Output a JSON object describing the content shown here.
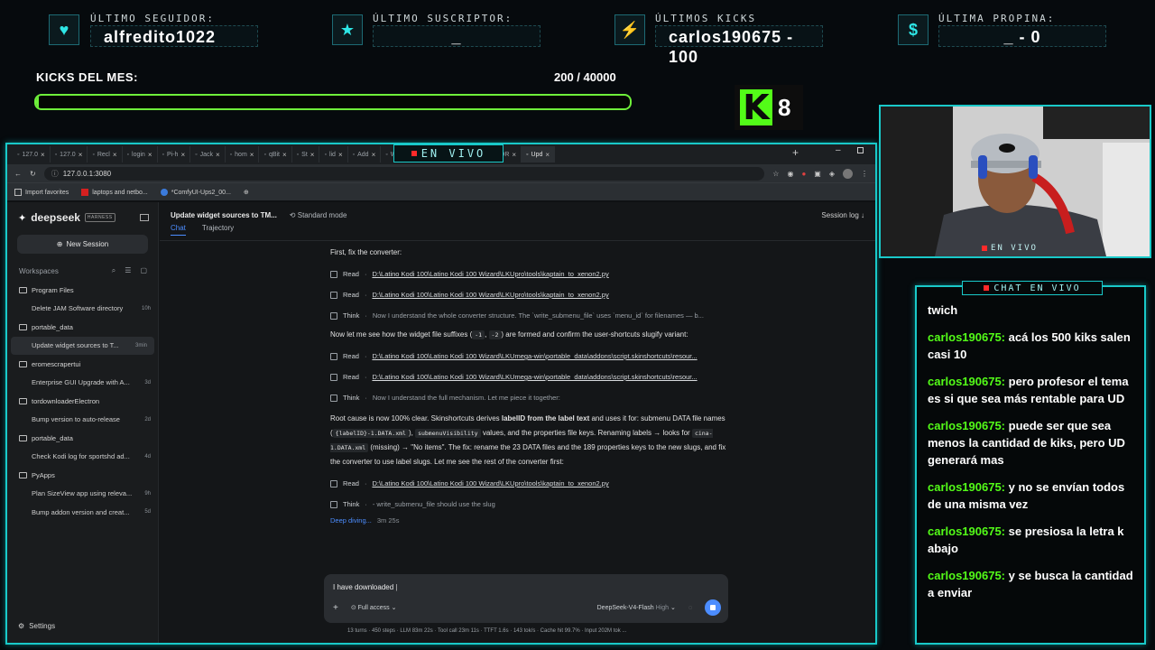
{
  "stats": [
    {
      "label": "ÚLTIMO SEGUIDOR:",
      "value": "alfredito1022",
      "icon": "heart-icon"
    },
    {
      "label": "ÚLTIMO SUSCRIPTOR:",
      "value": "_",
      "icon": "star-icon"
    },
    {
      "label": "ÚLTIMOS KICKS",
      "value": "carlos190675 - 100",
      "icon": "bolt-icon"
    },
    {
      "label": "ÚLTIMA PROPINA:",
      "value": "_ - 0",
      "icon": "dollar-icon"
    }
  ],
  "kicks": {
    "label": "KICKS DEL MES:",
    "count": "200 / 40000",
    "progress_percent": 0.5
  },
  "kick_badge": {
    "letter": "K",
    "number": "8"
  },
  "browser": {
    "tabs": [
      "127.0",
      "127.0",
      "Recl",
      "login",
      "Pi-h",
      "Jack",
      "hom",
      "qBit",
      "St",
      "lid",
      "Add",
      "Wan",
      "Sear",
      "Plain",
      "TOR",
      "Upd"
    ],
    "live_banner": "EN VIVO",
    "url": "127.0.0.1:3080",
    "bookmarks": [
      "Import favorites",
      "laptops and netbo...",
      "*ComfyUI-Ups2_00..."
    ]
  },
  "sidebar": {
    "logo": "deepseek",
    "badge": "HARNESS",
    "new_session": "New Session",
    "workspaces_label": "Workspaces",
    "groups": [
      {
        "name": "Program Files",
        "items": [
          {
            "title": "Delete JAM Software directory",
            "time": "10h"
          }
        ]
      },
      {
        "name": "portable_data",
        "items": [
          {
            "title": "Update widget sources to T...",
            "time": "3min"
          }
        ]
      },
      {
        "name": "eromescrapertui",
        "items": [
          {
            "title": "Enterprise GUI Upgrade with A...",
            "time": "3d"
          }
        ]
      },
      {
        "name": "tordownloaderElectron",
        "items": [
          {
            "title": "Bump version to auto-release",
            "time": "2d"
          }
        ]
      },
      {
        "name": "portable_data",
        "items": [
          {
            "title": "Check Kodi log for sportshd ad...",
            "time": "4d"
          }
        ]
      },
      {
        "name": "PyApps",
        "items": [
          {
            "title": "Plan SizeView app using releva...",
            "time": "9h"
          },
          {
            "title": "Bump addon version and creat...",
            "time": "5d"
          }
        ]
      }
    ],
    "settings": "Settings"
  },
  "main": {
    "title": "Update widget sources to TM...",
    "mode": "Standard mode",
    "session_log": "Session log",
    "tabs": [
      "Chat",
      "Trajectory"
    ],
    "p1": "First, fix the converter:",
    "read_label": "Read",
    "think_label": "Think",
    "path_a": "D:\\Latino Kodi 100\\Latino Kodi 100 Wizard\\LKUpro\\tools\\kaptain_to_xenon2.py",
    "path_b": "D:\\Latino Kodi 100\\Latino Kodi 100 Wizard\\LKUmega-win\\portable_data\\addons\\script.skinshortcuts\\resour...",
    "think1": "Now I understand the whole converter structure. The `write_submenu_file` uses `menu_id` for filenames — b...",
    "p2a": "Now let me see how the widget file suffixes (",
    "code1": "-1",
    "code2": "-2",
    "p2b": ") are formed and confirm the user-shortcuts slugify variant:",
    "think2": "Now I understand the full mechanism. Let me piece it together:",
    "p3a": "Root cause is now 100% clear. Skinshortcuts derives ",
    "p3b": "labelID from the label text",
    "p3c": " and uses it for: submenu DATA file names (",
    "code3": "{labelID}-1.DATA.xml",
    "p3d": "), ",
    "code4": "submenuVisibility",
    "p3e": " values, and the properties file keys. Renaming labels → looks for ",
    "code5": "cina-1.DATA.xml",
    "p3f": " (missing) → \"No items\". The fix: rename the 23 DATA files and the 189 properties keys to the new slugs, and fix the converter to use label slugs. Let me see the rest of the converter first:",
    "think3": "- write_submenu_file should use the slug",
    "deep": "Deep diving...",
    "deep_time": "3m 25s"
  },
  "composer": {
    "value": "I have downloaded",
    "access": "Full access",
    "model": "DeepSeek-V4-Flash",
    "level": "High",
    "status": "13 turns · 450 steps · LLM 83m 22s · Tool call 23m 11s · TTFT 1.6s · 143 tok/s · Cache hit 99.7% · Input 202M tok ..."
  },
  "cam": {
    "label": "EN VIVO"
  },
  "chat": {
    "title": "CHAT EN VIVO",
    "messages": [
      {
        "user": "",
        "text": "twich"
      },
      {
        "user": "carlos190675:",
        "text": " acá los 500 kiks salen casi 10"
      },
      {
        "user": "carlos190675:",
        "text": " pero profesor el tema es si que sea más rentable para UD"
      },
      {
        "user": "carlos190675:",
        "text": " puede ser que sea menos la cantidad de kiks, pero UD generará mas"
      },
      {
        "user": "carlos190675:",
        "text": " y no se envían todos de una misma vez"
      },
      {
        "user": "carlos190675:",
        "text": " se presiosa la letra k abajo"
      },
      {
        "user": "carlos190675:",
        "text": " y se busca la cantidad a enviar"
      }
    ]
  },
  "colors": {
    "accent": "#19c9c9",
    "kick_green": "#53fc18",
    "link_blue": "#4c8dff"
  }
}
